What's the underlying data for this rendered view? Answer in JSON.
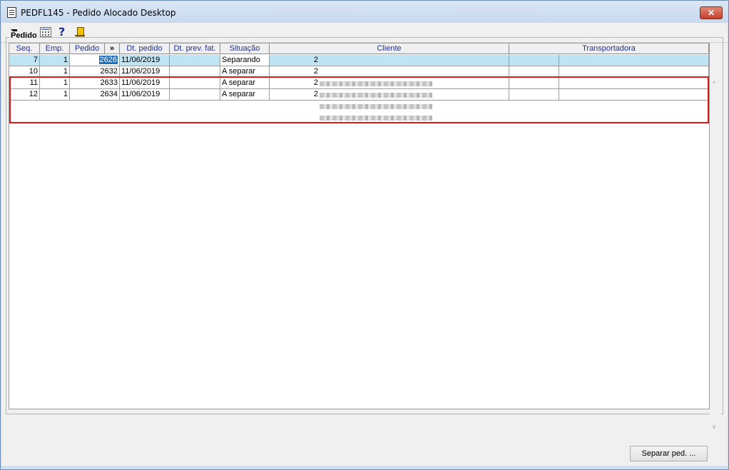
{
  "window": {
    "title": "PEDFL145 - Pedido Alocado Desktop",
    "close_label": "✕"
  },
  "toolbar": {
    "icons": [
      "arrow-icon",
      "calculator-icon",
      "help-icon",
      "exit-icon"
    ],
    "help_glyph": "?"
  },
  "group": {
    "label": "Pedido"
  },
  "grid": {
    "columns": [
      "Seq.",
      "Emp.",
      "Pedido",
      "»",
      "Dt. pedido",
      "Dt. prev. fat.",
      "Situação",
      "Cliente",
      "Transportadora"
    ],
    "rows": [
      {
        "seq": "7",
        "emp": "1",
        "pedido": "2626",
        "dt_pedido": "11/06/2019",
        "dt_prev": "",
        "situacao": "Separando",
        "cliente_code": "2",
        "transportadora": ""
      },
      {
        "seq": "10",
        "emp": "1",
        "pedido": "2632",
        "dt_pedido": "11/06/2019",
        "dt_prev": "",
        "situacao": "A separar",
        "cliente_code": "2",
        "transportadora": ""
      },
      {
        "seq": "11",
        "emp": "1",
        "pedido": "2633",
        "dt_pedido": "11/06/2019",
        "dt_prev": "",
        "situacao": "A separar",
        "cliente_code": "2",
        "transportadora": ""
      },
      {
        "seq": "12",
        "emp": "1",
        "pedido": "2634",
        "dt_pedido": "11/06/2019",
        "dt_prev": "",
        "situacao": "A separar",
        "cliente_code": "2",
        "transportadora": ""
      }
    ],
    "selected_row": 0
  },
  "scrollbar": {
    "up_glyph": "^",
    "down_glyph": "v"
  },
  "buttons": {
    "separar_label": "Separar ped. ..."
  },
  "colors": {
    "selected_row": "#bfe4f3",
    "highlight_border": "#e01818",
    "header_text": "#1f2f9a"
  }
}
